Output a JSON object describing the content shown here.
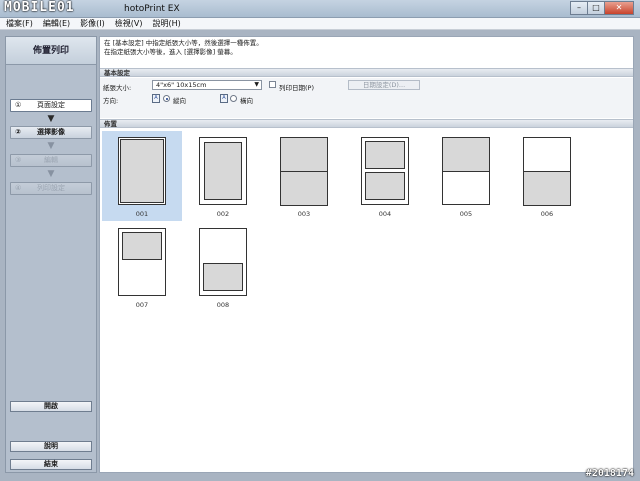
{
  "window": {
    "logo": "MOBILE01",
    "title": "hotoPrint EX",
    "minimize": "–",
    "maximize": "□",
    "close": "✕"
  },
  "menu": [
    "檔案(F)",
    "編輯(E)",
    "影像(I)",
    "檢視(V)",
    "說明(H)"
  ],
  "sidebar": {
    "header": "佈置列印",
    "steps": [
      {
        "num": "①",
        "label": "頁面設定"
      },
      {
        "num": "②",
        "label": "選擇影像"
      },
      {
        "num": "③",
        "label": "編輯"
      },
      {
        "num": "④",
        "label": "列印設定"
      }
    ],
    "open_button": "開啟",
    "help_button": "說明",
    "exit_button": "結束"
  },
  "instructions": {
    "line1": "在 [基本設定] 中指定紙張大小等，然後選擇一種佈置。",
    "line2": "在指定紙張大小等後，進入 [選擇影像] 螢幕。"
  },
  "basic_settings": {
    "section_title": "基本設定",
    "paper_size_label": "紙張大小:",
    "paper_size_value": "4\"x6\" 10x15cm",
    "print_date_label": "列印日期(P)",
    "date_settings_button": "日期設定(D)...",
    "orientation_label": "方向:",
    "portrait_label": "縱向",
    "landscape_label": "橫向",
    "orientation_icon": "A"
  },
  "layout": {
    "section_title": "佈置",
    "items": [
      "001",
      "002",
      "003",
      "004",
      "005",
      "006",
      "007",
      "008"
    ]
  },
  "watermark": "#2018174"
}
